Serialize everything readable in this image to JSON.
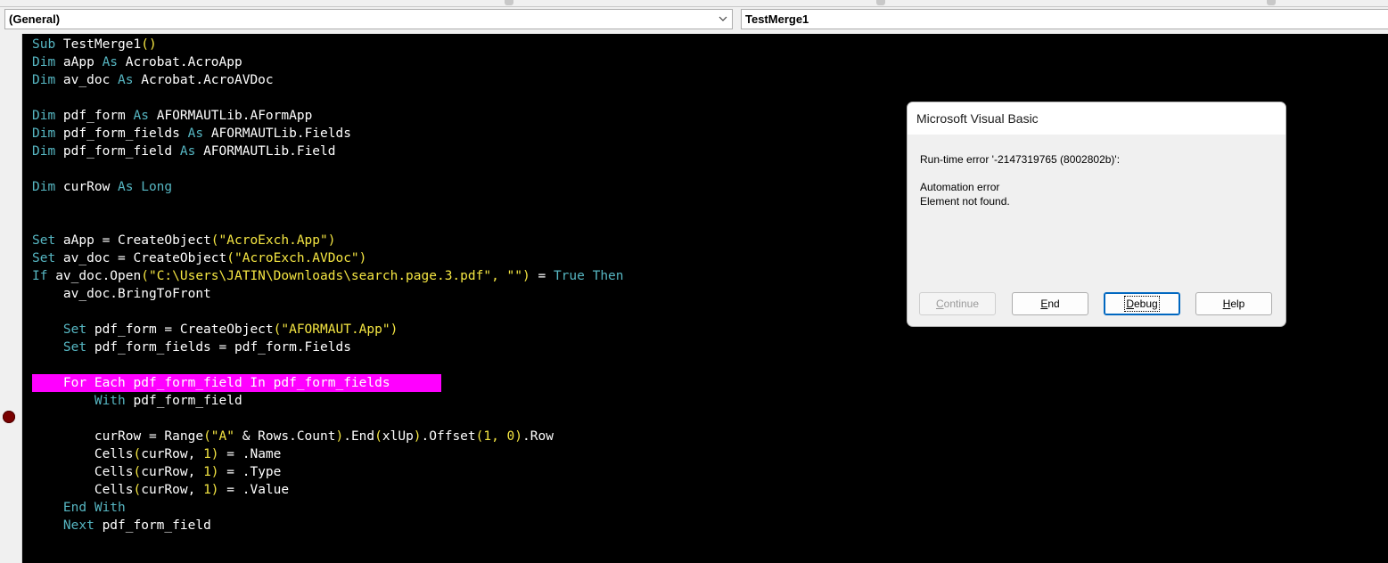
{
  "combos": {
    "object": "(General)",
    "procedure": "TestMerge1"
  },
  "code_lines": [
    [
      {
        "t": "Sub ",
        "c": "kw"
      },
      {
        "t": "TestMerge1",
        "c": "id"
      },
      {
        "t": "()",
        "c": "str"
      }
    ],
    [
      {
        "t": "Dim ",
        "c": "kw"
      },
      {
        "t": "aApp ",
        "c": "id"
      },
      {
        "t": "As ",
        "c": "kw"
      },
      {
        "t": "Acrobat.AcroApp",
        "c": "id"
      }
    ],
    [
      {
        "t": "Dim ",
        "c": "kw"
      },
      {
        "t": "av_doc ",
        "c": "id"
      },
      {
        "t": "As ",
        "c": "kw"
      },
      {
        "t": "Acrobat.AcroAVDoc",
        "c": "id"
      }
    ],
    [],
    [
      {
        "t": "Dim ",
        "c": "kw"
      },
      {
        "t": "pdf_form ",
        "c": "id"
      },
      {
        "t": "As ",
        "c": "kw"
      },
      {
        "t": "AFORMAUTLib.AFormApp",
        "c": "id"
      }
    ],
    [
      {
        "t": "Dim ",
        "c": "kw"
      },
      {
        "t": "pdf_form_fields ",
        "c": "id"
      },
      {
        "t": "As ",
        "c": "kw"
      },
      {
        "t": "AFORMAUTLib.Fields",
        "c": "id"
      }
    ],
    [
      {
        "t": "Dim ",
        "c": "kw"
      },
      {
        "t": "pdf_form_field ",
        "c": "id"
      },
      {
        "t": "As ",
        "c": "kw"
      },
      {
        "t": "AFORMAUTLib.Field",
        "c": "id"
      }
    ],
    [],
    [
      {
        "t": "Dim ",
        "c": "kw"
      },
      {
        "t": "curRow ",
        "c": "id"
      },
      {
        "t": "As Long",
        "c": "kw"
      }
    ],
    [],
    [],
    [
      {
        "t": "Set ",
        "c": "kw"
      },
      {
        "t": "aApp = CreateObject",
        "c": "id"
      },
      {
        "t": "(\"AcroExch.App\")",
        "c": "str"
      }
    ],
    [
      {
        "t": "Set ",
        "c": "kw"
      },
      {
        "t": "av_doc = CreateObject",
        "c": "id"
      },
      {
        "t": "(\"AcroExch.AVDoc\")",
        "c": "str"
      }
    ],
    [
      {
        "t": "If ",
        "c": "kw"
      },
      {
        "t": "av_doc.Open",
        "c": "id"
      },
      {
        "t": "(\"C:\\Users\\JATIN\\Downloads\\search.page.3.pdf\", \"\")",
        "c": "str"
      },
      {
        "t": " = ",
        "c": "id"
      },
      {
        "t": "True Then",
        "c": "kw"
      }
    ],
    [
      {
        "t": "    av_doc.BringToFront",
        "c": "id"
      }
    ],
    [],
    [
      {
        "t": "    ",
        "c": "id"
      },
      {
        "t": "Set ",
        "c": "kw"
      },
      {
        "t": "pdf_form = CreateObject",
        "c": "id"
      },
      {
        "t": "(\"AFORMAUT.App\")",
        "c": "str"
      }
    ],
    [
      {
        "t": "    ",
        "c": "id"
      },
      {
        "t": "Set ",
        "c": "kw"
      },
      {
        "t": "pdf_form_fields = pdf_form.Fields",
        "c": "id"
      }
    ],
    [],
    [
      {
        "t": "    For Each pdf_form_field In pdf_form_fields",
        "c": "id"
      }
    ],
    [
      {
        "t": "        ",
        "c": "id"
      },
      {
        "t": "With ",
        "c": "kw"
      },
      {
        "t": "pdf_form_field",
        "c": "id"
      }
    ],
    [],
    [
      {
        "t": "        curRow = Range",
        "c": "id"
      },
      {
        "t": "(\"A\" ",
        "c": "str"
      },
      {
        "t": "& Rows.Count",
        "c": "id"
      },
      {
        "t": ")",
        "c": "str"
      },
      {
        "t": ".End",
        "c": "id"
      },
      {
        "t": "(",
        "c": "str"
      },
      {
        "t": "xlUp",
        "c": "id"
      },
      {
        "t": ")",
        "c": "str"
      },
      {
        "t": ".Offset",
        "c": "id"
      },
      {
        "t": "(1, 0)",
        "c": "str"
      },
      {
        "t": ".Row",
        "c": "id"
      }
    ],
    [
      {
        "t": "        Cells",
        "c": "id"
      },
      {
        "t": "(",
        "c": "str"
      },
      {
        "t": "curRow, ",
        "c": "id"
      },
      {
        "t": "1)",
        "c": "str"
      },
      {
        "t": " = .Name",
        "c": "id"
      }
    ],
    [
      {
        "t": "        Cells",
        "c": "id"
      },
      {
        "t": "(",
        "c": "str"
      },
      {
        "t": "curRow, ",
        "c": "id"
      },
      {
        "t": "1)",
        "c": "str"
      },
      {
        "t": " = .Type",
        "c": "id"
      }
    ],
    [
      {
        "t": "        Cells",
        "c": "id"
      },
      {
        "t": "(",
        "c": "str"
      },
      {
        "t": "curRow, ",
        "c": "id"
      },
      {
        "t": "1)",
        "c": "str"
      },
      {
        "t": " = .Value",
        "c": "id"
      }
    ],
    [
      {
        "t": "    ",
        "c": "id"
      },
      {
        "t": "End With",
        "c": "kw"
      }
    ],
    [
      {
        "t": "    ",
        "c": "id"
      },
      {
        "t": "Next ",
        "c": "kw"
      },
      {
        "t": "pdf_form_field",
        "c": "id"
      }
    ]
  ],
  "highlighted_line_index": 19,
  "colors": {
    "keyword": "#56b6c2",
    "string": "#f5e642",
    "identifier": "#ffffff",
    "background": "#000000",
    "highlight": "#ff00ff",
    "breakpoint": "#7a0000"
  },
  "icons": {
    "breakpoint": "breakpoint-dot-icon",
    "combo_arrow": "chevron-down-icon"
  },
  "dialog": {
    "title": "Microsoft Visual Basic",
    "error_line": "Run-time error '-2147319765 (8002802b)':",
    "message_line1": "Automation error",
    "message_line2": "Element not found.",
    "buttons": {
      "continue": {
        "pre": "",
        "mnemonic": "C",
        "post": "ontinue",
        "enabled": false
      },
      "end": {
        "pre": "",
        "mnemonic": "E",
        "post": "nd",
        "enabled": true
      },
      "debug": {
        "pre": "",
        "mnemonic": "D",
        "post": "ebug",
        "enabled": true
      },
      "help": {
        "pre": "",
        "mnemonic": "H",
        "post": "elp",
        "enabled": true
      }
    }
  }
}
